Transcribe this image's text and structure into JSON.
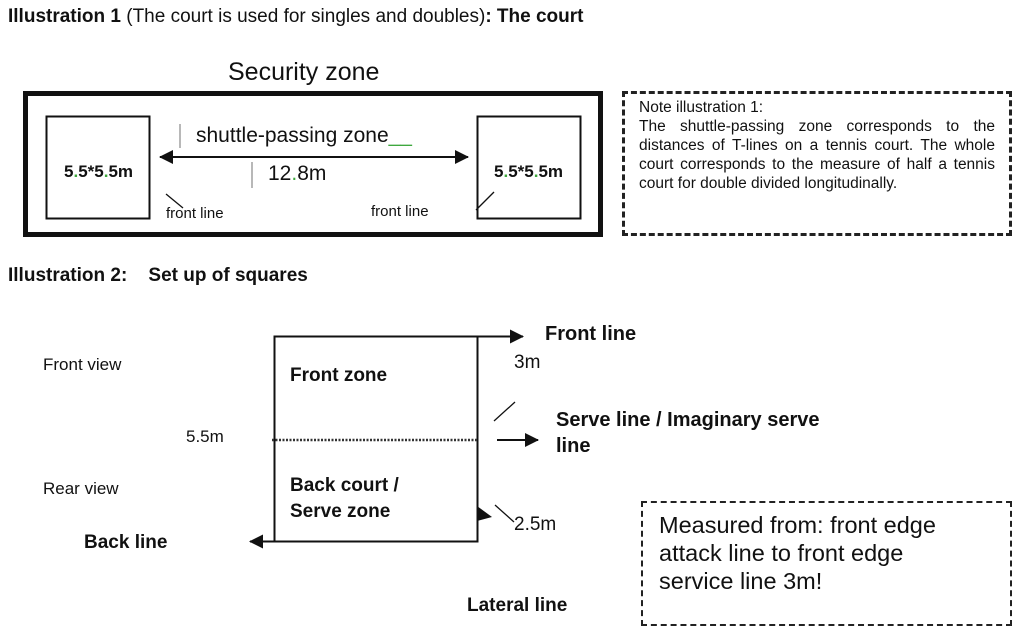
{
  "illustration1": {
    "heading_bold_prefix": "Illustration 1",
    "heading_normal": " (The court is used for singles and doubles)",
    "heading_bold_suffix": ": The court",
    "security_zone_label": "Security zone",
    "left_square_label_parts": [
      "5",
      ".",
      "5*5",
      ".",
      "5m"
    ],
    "right_square_label_parts": [
      "5",
      ".",
      "5*5",
      ".",
      "5m"
    ],
    "passing_zone_label": "shuttle-passing zone",
    "passing_zone_trailing_mark": "__",
    "distance_label_parts": [
      "12",
      ".",
      "8m"
    ],
    "front_line_left": "front line",
    "front_line_right": "front line",
    "highlight_color": "#3fa83f"
  },
  "note1": {
    "title": "Note illustration 1:",
    "body": "The shuttle-passing zone corresponds to the distances of T-lines on a tennis court. The whole court corresponds to the measure of half a tennis court for double divided longitudinally."
  },
  "illustration2": {
    "heading": "Illustration 2:    Set up of squares",
    "front_view": "Front view",
    "rear_view": "Rear view",
    "side_measure": "5.5m",
    "front_zone": "Front zone",
    "back_zone": "Back court /\nServe zone",
    "front_line": "Front line",
    "front_measure": "3m",
    "serve_line": "Serve line / Imaginary serve\nline",
    "back_line": "Back line",
    "back_measure": "2.5m",
    "lateral_line": "Lateral line"
  },
  "note2": {
    "text": "Measured from: front edge\nattack line to front edge\nservice line 3m!"
  }
}
